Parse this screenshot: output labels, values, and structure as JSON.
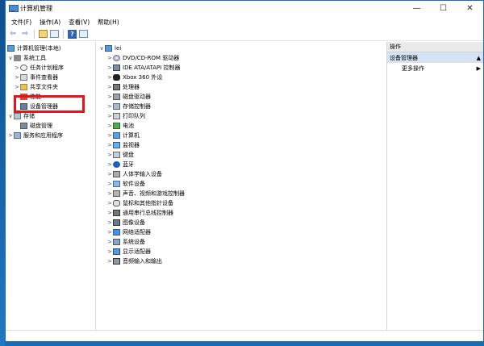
{
  "window": {
    "title": "计算机管理",
    "minimize": "—",
    "maximize": "☐",
    "close": "✕"
  },
  "menu": [
    "文件(F)",
    "操作(A)",
    "查看(V)",
    "帮助(H)"
  ],
  "toolbar": {
    "back": "⇦",
    "forward": "⇨",
    "help": "?"
  },
  "left_tree": [
    {
      "label": "计算机管理(本地)",
      "icon": "computer-icon",
      "expander": "",
      "indent": 0
    },
    {
      "label": "系统工具",
      "icon": "tools-icon",
      "expander": "∨",
      "indent": 1
    },
    {
      "label": "任务计划程序",
      "icon": "clock-icon",
      "expander": ">",
      "indent": 2
    },
    {
      "label": "事件查看器",
      "icon": "event-icon",
      "expander": ">",
      "indent": 2
    },
    {
      "label": "共享文件夹",
      "icon": "shared-folder-icon",
      "expander": ">",
      "indent": 2
    },
    {
      "label": "性能",
      "icon": "performance-icon",
      "expander": ">",
      "indent": 2
    },
    {
      "label": "设备管理器",
      "icon": "device-manager-icon",
      "expander": "",
      "indent": 2
    },
    {
      "label": "存储",
      "icon": "storage-icon",
      "expander": "∨",
      "indent": 1
    },
    {
      "label": "磁盘管理",
      "icon": "disk-icon",
      "expander": "",
      "indent": 2
    },
    {
      "label": "服务和应用程序",
      "icon": "services-icon",
      "expander": ">",
      "indent": 1
    }
  ],
  "device_tree": {
    "root": {
      "label": "lei",
      "expander": "∨"
    },
    "items": [
      {
        "label": "DVD/CD-ROM 驱动器",
        "icon": "cd-rom-icon"
      },
      {
        "label": "IDE ATA/ATAPI 控制器",
        "icon": "ide-controller-icon"
      },
      {
        "label": "Xbox 360 外设",
        "icon": "xbox-icon"
      },
      {
        "label": "处理器",
        "icon": "processor-icon"
      },
      {
        "label": "磁盘驱动器",
        "icon": "disk-drive-icon"
      },
      {
        "label": "存储控制器",
        "icon": "storage-controller-icon"
      },
      {
        "label": "打印队列",
        "icon": "printer-icon"
      },
      {
        "label": "电池",
        "icon": "battery-icon"
      },
      {
        "label": "计算机",
        "icon": "computer-icon"
      },
      {
        "label": "监视器",
        "icon": "monitor-icon"
      },
      {
        "label": "键盘",
        "icon": "keyboard-icon"
      },
      {
        "label": "蓝牙",
        "icon": "bluetooth-icon"
      },
      {
        "label": "人体学输入设备",
        "icon": "hid-icon"
      },
      {
        "label": "软件设备",
        "icon": "software-device-icon"
      },
      {
        "label": "声音、视频和游戏控制器",
        "icon": "sound-icon"
      },
      {
        "label": "鼠标和其他指针设备",
        "icon": "mouse-icon"
      },
      {
        "label": "通用串行总线控制器",
        "icon": "usb-icon"
      },
      {
        "label": "图像设备",
        "icon": "imaging-icon"
      },
      {
        "label": "网络适配器",
        "icon": "network-icon"
      },
      {
        "label": "系统设备",
        "icon": "system-device-icon"
      },
      {
        "label": "显示适配器",
        "icon": "display-adapter-icon"
      },
      {
        "label": "音频输入和输出",
        "icon": "audio-io-icon"
      }
    ]
  },
  "actions": {
    "header": "操作",
    "section": "设备管理器",
    "section_arrow": "▲",
    "more": "更多操作",
    "more_arrow": "▶"
  },
  "colors": {
    "highlight": "#e8131a",
    "accent": "#1f6fb8"
  }
}
